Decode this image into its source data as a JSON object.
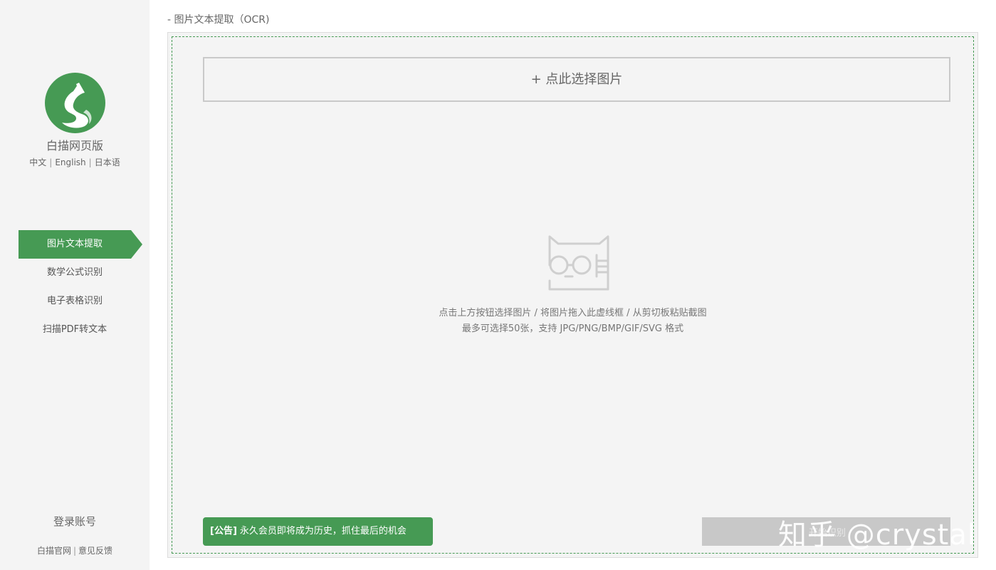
{
  "sidebar": {
    "app_name": "白描网页版",
    "languages": [
      "中文",
      "English",
      "日本语"
    ],
    "nav": [
      {
        "label": "图片文本提取",
        "active": true
      },
      {
        "label": "数学公式识别",
        "active": false
      },
      {
        "label": "电子表格识别",
        "active": false
      },
      {
        "label": "扫描PDF转文本",
        "active": false
      }
    ],
    "login": "登录账号",
    "footer": {
      "official_site": "白描官网",
      "feedback": "意见反馈"
    }
  },
  "main": {
    "page_title": "- 图片文本提取（OCR)",
    "select_button": "+ 点此选择图片",
    "hint_line1": "点击上方按钮选择图片 / 将图片拖入此虚线框 / 从剪切板粘贴截图",
    "hint_line2": "最多可选择50张，支持 JPG/PNG/BMP/GIF/SVG 格式",
    "notice_tag": "[公告]",
    "notice_text": "永久会员即将成为历史，抓住最后的机会",
    "gray_bar_label": "开始识别",
    "watermark": "知乎 @crystal"
  },
  "colors": {
    "accent": "#469a54",
    "sidebar_bg": "#f4f4f4",
    "workspace_bg": "#f4f4f4"
  },
  "icons": {
    "logo": "baimiao-cat-logo",
    "empty_state": "cat-with-glasses-icon"
  }
}
